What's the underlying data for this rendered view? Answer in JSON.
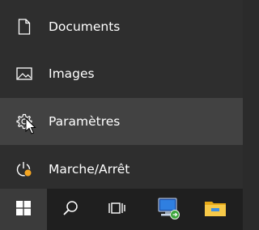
{
  "start_menu": {
    "items": [
      {
        "label": "Documents",
        "icon": "document-icon"
      },
      {
        "label": "Images",
        "icon": "image-icon"
      },
      {
        "label": "Paramètres",
        "icon": "gear-icon",
        "hovered": true
      },
      {
        "label": "Marche/Arrêt",
        "icon": "power-icon",
        "badge_color": "#f5a623"
      }
    ]
  },
  "taskbar": {
    "buttons": [
      {
        "name": "start",
        "icon": "windows-logo-icon"
      },
      {
        "name": "search",
        "icon": "search-icon"
      },
      {
        "name": "task-view",
        "icon": "task-view-icon"
      },
      {
        "name": "network",
        "icon": "network-computer-icon"
      },
      {
        "name": "file-explorer",
        "icon": "folder-icon"
      }
    ]
  },
  "colors": {
    "menu_bg": "#2e2e2e",
    "hover_bg": "#424242",
    "taskbar_bg": "#1f1f1f",
    "start_active_bg": "#3b3b3b",
    "power_badge": "#f5a623"
  }
}
